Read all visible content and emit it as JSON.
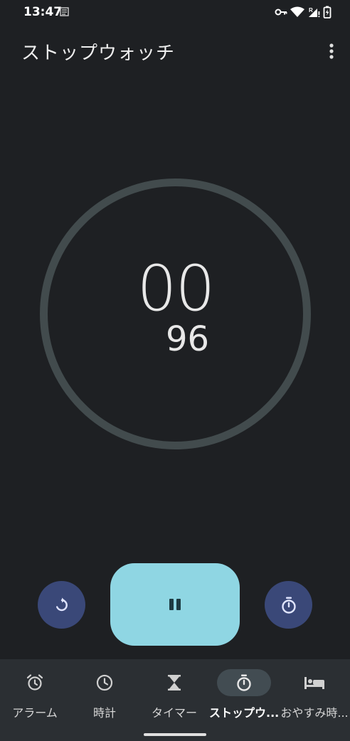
{
  "status_bar": {
    "time": "13:47",
    "icons": [
      "notification-icon",
      "vpn-key-icon",
      "wifi-icon",
      "cell-signal-roaming-icon",
      "battery-charging-icon"
    ]
  },
  "app_bar": {
    "title": "ストップウォッチ",
    "overflow_icon": "more-vert-icon"
  },
  "stopwatch": {
    "seconds": "00",
    "hundredths": "96",
    "ring_color": "#424b4d"
  },
  "controls": {
    "reset_icon": "reset-icon",
    "pause_icon": "pause-icon",
    "lap_icon": "lap-timer-icon",
    "accent_color": "#8fd6e3",
    "secondary_color": "#3a4878"
  },
  "bottom_nav": {
    "items": [
      {
        "label": "アラーム",
        "icon": "alarm-icon"
      },
      {
        "label": "時計",
        "icon": "clock-icon"
      },
      {
        "label": "タイマー",
        "icon": "hourglass-icon"
      },
      {
        "label": "ストップウ...",
        "icon": "stopwatch-icon",
        "active": true
      },
      {
        "label": "おやすみ時...",
        "icon": "bed-icon"
      }
    ]
  }
}
